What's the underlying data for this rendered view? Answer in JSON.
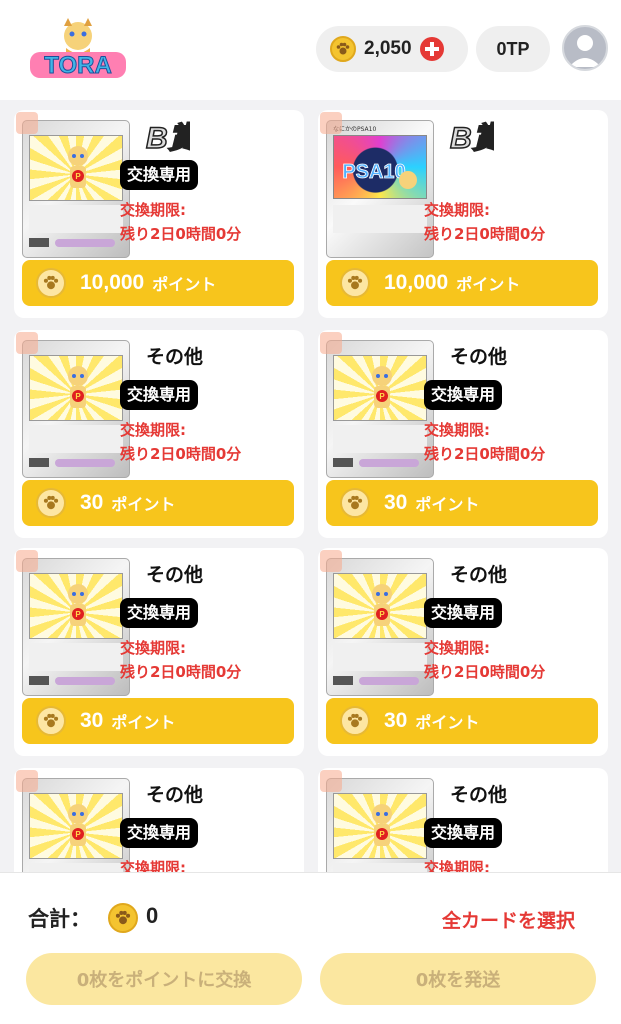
{
  "header": {
    "logo_text": "TORA",
    "coin_balance": "2,050",
    "tp_balance": "0TP",
    "coin_icon": "paw-coin-icon",
    "add_icon": "plus-icon",
    "avatar_icon": "user-avatar-icon"
  },
  "cards": [
    {
      "grade": "B賞",
      "badge": "交換専用",
      "deadline_label": "交換期限:",
      "deadline_value": "残り2日0時間0分",
      "points": "10,000",
      "points_unit": "ポイント",
      "type": "pt-card"
    },
    {
      "grade": "B賞",
      "badge": "",
      "deadline_label": "交換期限:",
      "deadline_value": "残り2日0時間0分",
      "points": "10,000",
      "points_unit": "ポイント",
      "type": "psa-card",
      "card_title": "なにかのPSA10"
    },
    {
      "grade": "その他",
      "badge": "交換専用",
      "deadline_label": "交換期限:",
      "deadline_value": "残り2日0時間0分",
      "points": "30",
      "points_unit": "ポイント",
      "type": "pt-card"
    },
    {
      "grade": "その他",
      "badge": "交換専用",
      "deadline_label": "交換期限:",
      "deadline_value": "残り2日0時間0分",
      "points": "30",
      "points_unit": "ポイント",
      "type": "pt-card"
    },
    {
      "grade": "その他",
      "badge": "交換専用",
      "deadline_label": "交換期限:",
      "deadline_value": "残り2日0時間0分",
      "points": "30",
      "points_unit": "ポイント",
      "type": "pt-card"
    },
    {
      "grade": "その他",
      "badge": "交換専用",
      "deadline_label": "交換期限:",
      "deadline_value": "残り2日0時間0分",
      "points": "30",
      "points_unit": "ポイント",
      "type": "pt-card"
    },
    {
      "grade": "その他",
      "badge": "交換専用",
      "deadline_label": "交換期限:",
      "deadline_value": "",
      "points": "",
      "points_unit": "",
      "type": "pt-card"
    },
    {
      "grade": "その他",
      "badge": "交換専用",
      "deadline_label": "交換期限:",
      "deadline_value": "",
      "points": "",
      "points_unit": "",
      "type": "pt-card"
    }
  ],
  "footer": {
    "total_label": "合計：",
    "total_value": "0",
    "select_all": "全カードを選択",
    "exchange_button": "0枚をポイントに交換",
    "ship_button": "0枚を発送"
  },
  "colors": {
    "accent_yellow": "#f7c51c",
    "danger_red": "#e53935",
    "disabled_button": "#fbe7a0"
  }
}
